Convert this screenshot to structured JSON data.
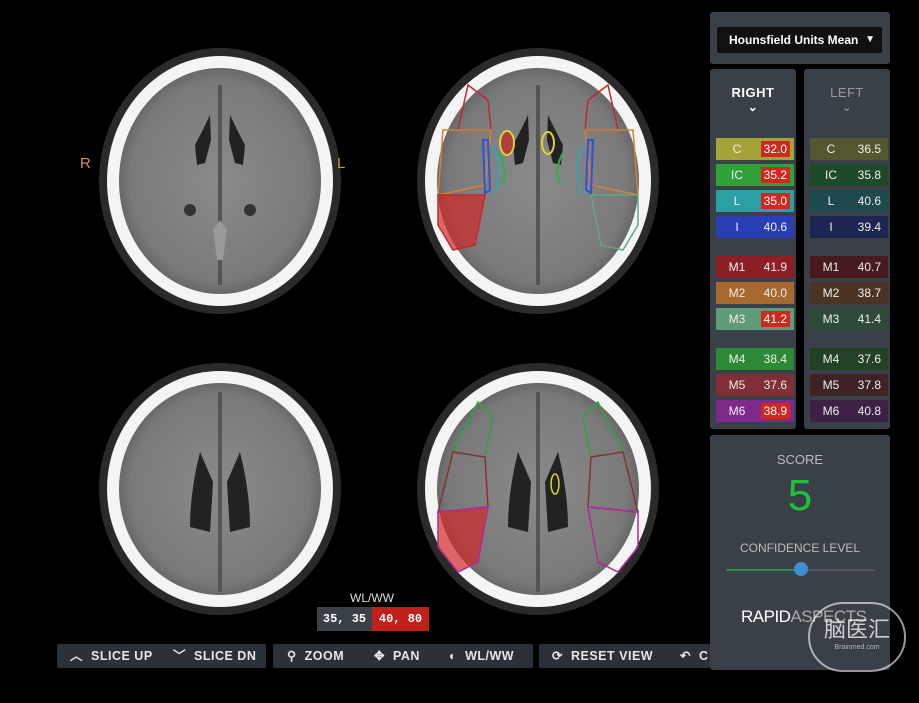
{
  "orientation": {
    "right": "R",
    "left": "L"
  },
  "metric_dropdown": {
    "value": "Hounsfield Units Mean",
    "caret": "▼"
  },
  "columns": {
    "right": {
      "title": "RIGHT",
      "chevron": "⌄"
    },
    "left": {
      "title": "LEFT",
      "chevron": "⌄"
    }
  },
  "regions": [
    {
      "label": "C",
      "color": "#a3a33a",
      "right": "32.0",
      "right_flag": true,
      "left": "36.5",
      "left_color": "#555730"
    },
    {
      "label": "IC",
      "color": "#2ea13a",
      "right": "35.2",
      "right_flag": true,
      "left": "35.8",
      "left_color": "#1f4a27"
    },
    {
      "label": "L",
      "color": "#2aa0a6",
      "right": "35.0",
      "right_flag": true,
      "left": "40.6",
      "left_color": "#1f4a4d"
    },
    {
      "label": "I",
      "color": "#2b3fb5",
      "right": "40.6",
      "right_flag": false,
      "left": "39.4",
      "left_color": "#1d2553"
    },
    {
      "label": "M1",
      "color": "#8c1f25",
      "right": "41.9",
      "right_flag": false,
      "left": "40.7",
      "left_color": "#471a1e"
    },
    {
      "label": "M2",
      "color": "#a8692e",
      "right": "40.0",
      "right_flag": false,
      "left": "38.7",
      "left_color": "#4b3423"
    },
    {
      "label": "M3",
      "color": "#5f9a79",
      "right": "41.2",
      "right_flag": true,
      "left": "41.4",
      "left_color": "#2f4a3b"
    },
    {
      "label": "M4",
      "color": "#2c8a36",
      "right": "38.4",
      "right_flag": false,
      "left": "37.6",
      "left_color": "#214225"
    },
    {
      "label": "M5",
      "color": "#7f2f35",
      "right": "37.6",
      "right_flag": false,
      "left": "37.8",
      "left_color": "#3f2226"
    },
    {
      "label": "M6",
      "color": "#7e2a8c",
      "right": "38.9",
      "right_flag": true,
      "left": "40.8",
      "left_color": "#3e2245"
    }
  ],
  "score": {
    "label": "SCORE",
    "value": "5",
    "color": "#22c03a"
  },
  "confidence": {
    "label": "CONFIDENCE LEVEL",
    "level": 0.5
  },
  "brand": {
    "bold": "RAPID",
    "light": "ASPECTS"
  },
  "watermark": {
    "text": "脑医汇",
    "sub": "Brainmed.com"
  },
  "window_level": {
    "label": "WL/WW",
    "current": "35, 35",
    "preset": "40, 80"
  },
  "toolbar": {
    "slice_up": "SLICE UP",
    "slice_dn": "SLICE DN",
    "zoom": "ZOOM",
    "pan": "PAN",
    "wlww": "WL/WW",
    "reset_view": "RESET VIEW",
    "truncated": "C"
  }
}
